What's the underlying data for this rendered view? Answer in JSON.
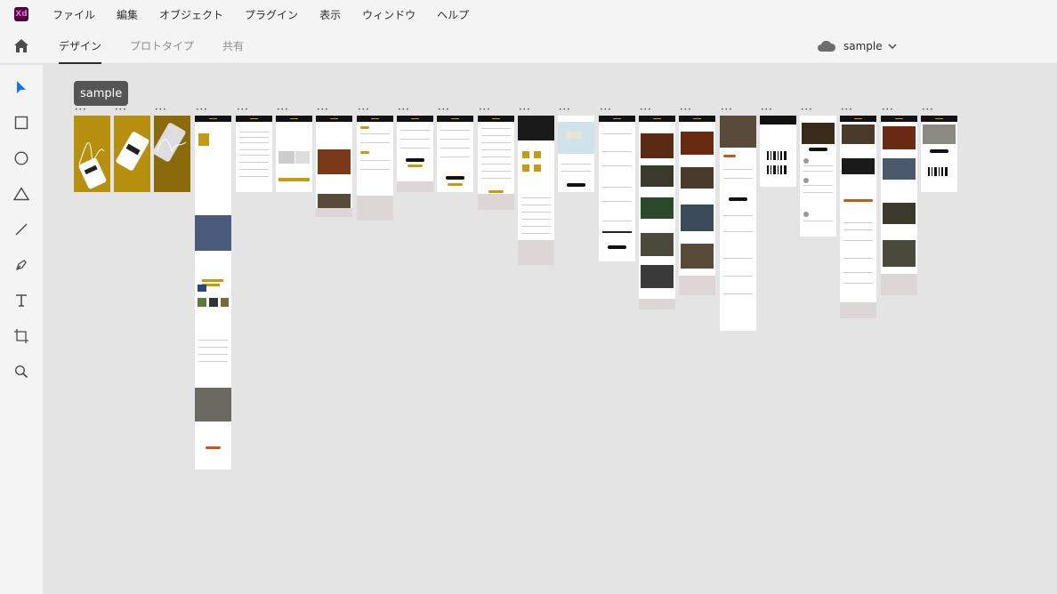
{
  "app": {
    "logo_text": "Xd",
    "menu": [
      "ファイル",
      "編集",
      "オブジェクト",
      "プラグイン",
      "表示",
      "ウィンドウ",
      "ヘルプ"
    ]
  },
  "modes": {
    "tabs": [
      "デザイン",
      "プロトタイプ",
      "共有"
    ],
    "active": "デザイン"
  },
  "document": {
    "title": "sample"
  },
  "tools": [
    "select-icon",
    "rectangle-icon",
    "ellipse-icon",
    "polygon-icon",
    "line-icon",
    "pen-icon",
    "text-icon",
    "artboard-icon",
    "zoom-icon"
  ],
  "canvas": {
    "page_label": "sample"
  },
  "colors": {
    "accent_blue": "#1473e6",
    "brand_gold": "#c59b13",
    "xd_purple": "#470137",
    "xd_pink": "#ff61f6"
  }
}
